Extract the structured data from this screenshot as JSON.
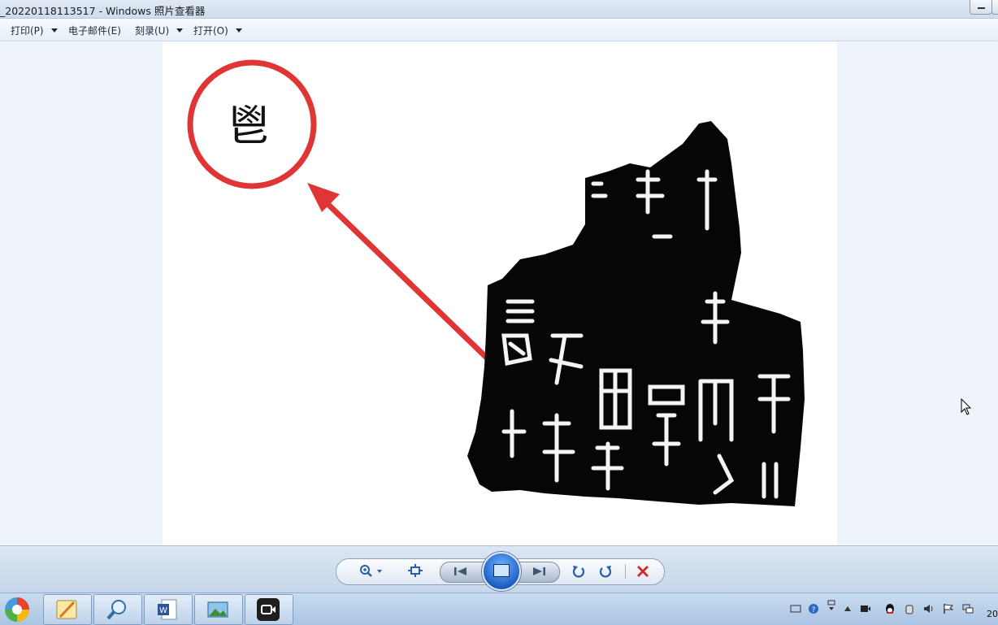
{
  "window": {
    "title": "_20220118113517 - Windows 照片查看器"
  },
  "menu": {
    "items": [
      {
        "label": "打印(P)",
        "has_dropdown": true
      },
      {
        "label": "电子邮件(E)",
        "has_dropdown": false
      },
      {
        "label": "刻录(U)",
        "has_dropdown": true
      },
      {
        "label": "打开(O)",
        "has_dropdown": true
      }
    ]
  },
  "image": {
    "character": "鬯",
    "accent_color": "#e03535"
  },
  "controls": {
    "icons": [
      "zoom-icon",
      "fit-window-icon",
      "previous-icon",
      "slideshow-icon",
      "next-icon",
      "rotate-counterclockwise-icon",
      "rotate-clockwise-icon",
      "delete-icon"
    ]
  },
  "taskbar": {
    "apps": [
      "start-orb-icon",
      "pen-app-icon",
      "magnifier-app-icon",
      "word-app-icon",
      "photo-viewer-app-icon",
      "video-app-icon"
    ],
    "clock": "20"
  }
}
